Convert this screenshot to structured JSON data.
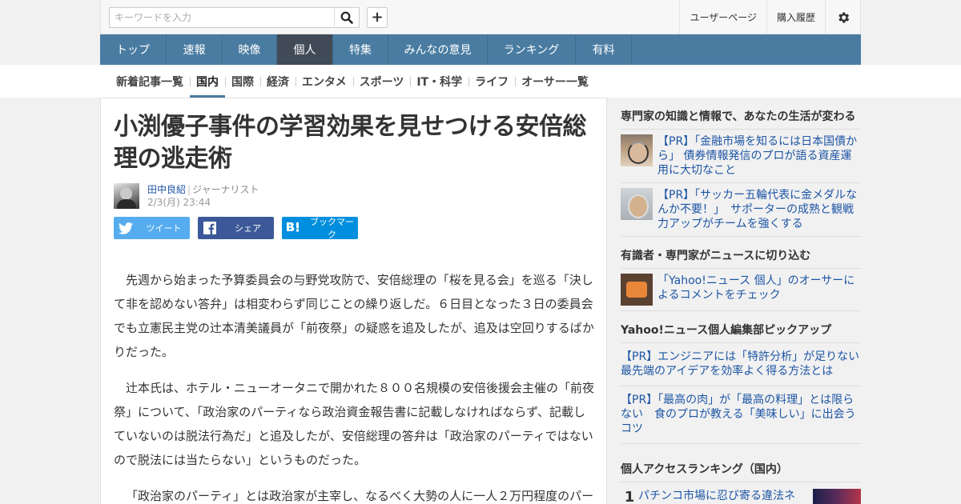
{
  "header": {
    "search_placeholder": "キーワードを入力",
    "search_icon": "search-icon",
    "add_icon": "plus-icon",
    "add_label": "+",
    "links": [
      "ユーザーページ",
      "購入履歴"
    ],
    "settings_icon": "gear-icon"
  },
  "main_nav": {
    "items": [
      "トップ",
      "速報",
      "映像",
      "個人",
      "特集",
      "みんなの意見",
      "ランキング",
      "有料"
    ],
    "active": "個人"
  },
  "sub_nav": {
    "items": [
      "新着記事一覧",
      "国内",
      "国際",
      "経済",
      "エンタメ",
      "スポーツ",
      "IT・科学",
      "ライフ",
      "オーサー一覧"
    ],
    "active": "国内"
  },
  "article": {
    "title": "小渕優子事件の学習効果を見せつける安倍総理の逃走術",
    "author_name": "田中良紹",
    "author_sep": "|",
    "author_role": "ジャーナリスト",
    "date": "2/3(月) 23:44",
    "share": {
      "twitter_label": "ツイート",
      "facebook_label": "シェア",
      "hatena_label": "ブックマーク",
      "twitter_icon": "twitter-icon",
      "facebook_icon": "facebook-icon",
      "hatena_icon": "hatena-bookmark-icon"
    },
    "paragraphs": [
      "先週から始まった予算委員会の与野党攻防で、安倍総理の「桜を見る会」を巡る「決して非を認めない答弁」は相変わらず同じことの繰り返しだ。６日目となった３日の委員会でも立憲民主党の辻本清美議員が「前夜祭」の疑惑を追及したが、追及は空回りするばかりだった。",
      "辻本氏は、ホテル・ニューオータニで開かれた８００名規模の安倍後援会主催の「前夜祭」について、「政治家のパーティなら政治資金報告書に記載しなければならず、記載していないのは脱法行為だ」と追及したが、安倍総理の答弁は「政治家のパーティではないので脱法には当たらない」というものだった。",
      "「政治家のパーティ」とは政治家が主宰し、なるべく大勢の人に一人２万円程度のパー"
    ]
  },
  "sidebar": {
    "sections": [
      {
        "title": "専門家の知識と情報で、あなたの生活が変わる",
        "items": [
          {
            "text": "【PR】「金融市場を知るには日本国債から」 債券情報発信のプロが語る資産運用に大切なこと",
            "thumb": "expert-photo-1"
          },
          {
            "text": "【PR】「サッカー五輪代表に金メダルなんか不要！」　サポーターの成熟と観戦力アップがチームを強くする",
            "thumb": "expert-photo-2"
          }
        ]
      },
      {
        "title": "有識者・専門家がニュースに切り込む",
        "items": [
          {
            "text": "「Yahoo!ニュース 個人」のオーサーによるコメントをチェック",
            "thumb": "comment-icon"
          }
        ]
      },
      {
        "title": "Yahoo!ニュース個人編集部ピックアップ",
        "items": [
          {
            "text": "【PR】エンジニアには「特許分析」が足りない　最先端のアイデアを効率よく得る方法とは"
          },
          {
            "text": "【PR】「最高の肉」が「最高の料理」とは限らない　食のプロが教える「美味しい」に出会うコツ"
          }
        ]
      },
      {
        "title": "個人アクセスランキング（国内）",
        "ranking": [
          {
            "rank": "1",
            "text": "パチンコ市場に忍び寄る違法ネ"
          }
        ]
      }
    ]
  }
}
